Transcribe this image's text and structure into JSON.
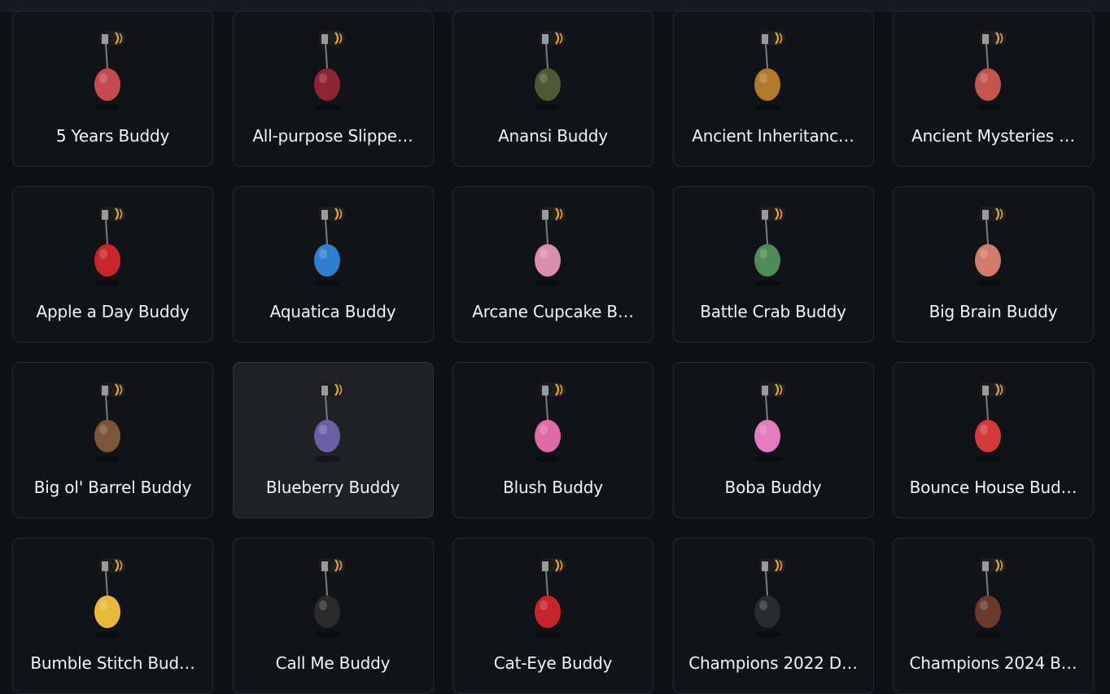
{
  "colors": {
    "background": "#0f1117",
    "card": "#111318",
    "card_border": "#262a34",
    "card_selected": "#1f2127",
    "text": "#f3f4f6",
    "clip_accent": "#e8a33a"
  },
  "buddies": [
    {
      "name": "5 Years Buddy",
      "icon": "cake-slice-charm-icon",
      "color": "#c44a52"
    },
    {
      "name": "All-purpose Slippe…",
      "icon": "slipper-charm-icon",
      "color": "#8e2430"
    },
    {
      "name": "Anansi Buddy",
      "icon": "spider-charm-icon",
      "color": "#4b5a32"
    },
    {
      "name": "Ancient Inheritanc…",
      "icon": "golden-mask-charm-icon",
      "color": "#b07a2a"
    },
    {
      "name": "Ancient Mysteries …",
      "icon": "octopus-charm-icon",
      "color": "#c4544e"
    },
    {
      "name": "Apple a Day Buddy",
      "icon": "apple-charm-icon",
      "color": "#c8262a"
    },
    {
      "name": "Aquatica Buddy",
      "icon": "manta-ray-charm-icon",
      "color": "#2f7fd0"
    },
    {
      "name": "Arcane Cupcake B…",
      "icon": "cupcake-charm-icon",
      "color": "#d98fb0"
    },
    {
      "name": "Battle Crab Buddy",
      "icon": "crab-charm-icon",
      "color": "#4f8a5a"
    },
    {
      "name": "Big Brain Buddy",
      "icon": "brain-charm-icon",
      "color": "#d47a6c"
    },
    {
      "name": "Big ol' Barrel Buddy",
      "icon": "barrel-charm-icon",
      "color": "#7a5538"
    },
    {
      "name": "Blueberry Buddy",
      "icon": "blueberry-kettlebell-charm-icon",
      "color": "#6a5fa8"
    },
    {
      "name": "Blush Buddy",
      "icon": "blush-diamond-charm-icon",
      "color": "#e06aa8"
    },
    {
      "name": "Boba Buddy",
      "icon": "boba-tea-charm-icon",
      "color": "#e57bbf"
    },
    {
      "name": "Bounce House Bud…",
      "icon": "bounce-house-charm-icon",
      "color": "#d33a3a"
    },
    {
      "name": "Bumble Stitch Bud…",
      "icon": "bee-charm-icon",
      "color": "#e8b93a"
    },
    {
      "name": "Call Me Buddy",
      "icon": "phone-card-charm-icon",
      "color": "#2a2a2a"
    },
    {
      "name": "Cat-Eye Buddy",
      "icon": "cat-eye-glasses-charm-icon",
      "color": "#c8242e"
    },
    {
      "name": "Champions 2022 D…",
      "icon": "champions-cap-charm-icon",
      "color": "#2a2b2e"
    },
    {
      "name": "Champions 2024 B…",
      "icon": "champions-tassel-charm-icon",
      "color": "#6a3a2e"
    }
  ],
  "selected_index": 11
}
